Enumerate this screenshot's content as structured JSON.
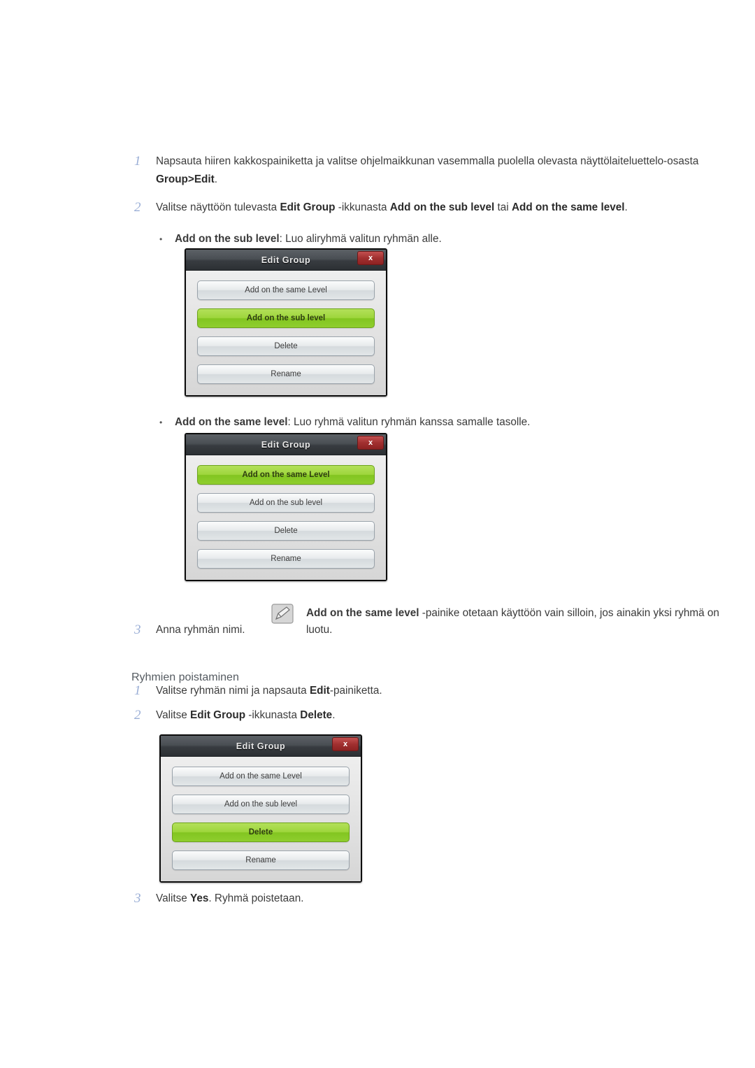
{
  "steps_add": [
    {
      "num": "1",
      "html": "Napsauta hiiren kakkospainiketta ja valitse ohjelmaikkunan vasemmalla puolella olevasta näyttölaiteluettelo-osasta <b>Group&gt;Edit</b>."
    },
    {
      "num": "2",
      "html": "Valitse näyttöön tulevasta <b>Edit Group</b> -ikkunasta <b>Add on the sub level</b> tai <b>Add on the same level</b>."
    }
  ],
  "bullets": [
    {
      "dot": "•",
      "html": "<b>Add on the sub level</b>: Luo aliryhmä valitun ryhmän alle."
    },
    {
      "dot": "•",
      "html": "<b>Add on the same level</b>: Luo ryhmä valitun ryhmän kanssa samalle tasolle."
    }
  ],
  "dialog1": {
    "title": "Edit Group",
    "close_label": "x",
    "buttons": [
      {
        "label": "Add on the same Level",
        "selected": false
      },
      {
        "label": "Add on the sub level",
        "selected": true
      },
      {
        "label": "Delete",
        "selected": false
      },
      {
        "label": "Rename",
        "selected": false
      }
    ]
  },
  "dialog2": {
    "title": "Edit Group",
    "close_label": "x",
    "buttons": [
      {
        "label": "Add on the same Level",
        "selected": true
      },
      {
        "label": "Add on the sub level",
        "selected": false
      },
      {
        "label": "Delete",
        "selected": false
      },
      {
        "label": "Rename",
        "selected": false
      }
    ]
  },
  "dialog3": {
    "title": "Edit Group",
    "close_label": "x",
    "buttons": [
      {
        "label": "Add on the same Level",
        "selected": false
      },
      {
        "label": "Add on the sub level",
        "selected": false
      },
      {
        "label": "Delete",
        "selected": true
      },
      {
        "label": "Rename",
        "selected": false
      }
    ]
  },
  "note": {
    "icon": "note-pencil-icon",
    "html": "<b>Add on the same level</b> -painike otetaan käyttöön vain silloin, jos ainakin yksi ryhmä on luotu."
  },
  "step3_add": {
    "num": "3",
    "html": "Anna ryhmän nimi."
  },
  "section_heading": "Ryhmien poistaminen",
  "steps_delete": [
    {
      "num": "1",
      "html": "Valitse ryhmän nimi ja napsauta <b>Edit</b>-painiketta."
    },
    {
      "num": "2",
      "html": "Valitse <b>Edit Group</b> -ikkunasta <b>Delete</b>."
    }
  ],
  "step3_delete": {
    "num": "3",
    "html": "Valitse <b>Yes</b>. Ryhmä poistetaan."
  }
}
